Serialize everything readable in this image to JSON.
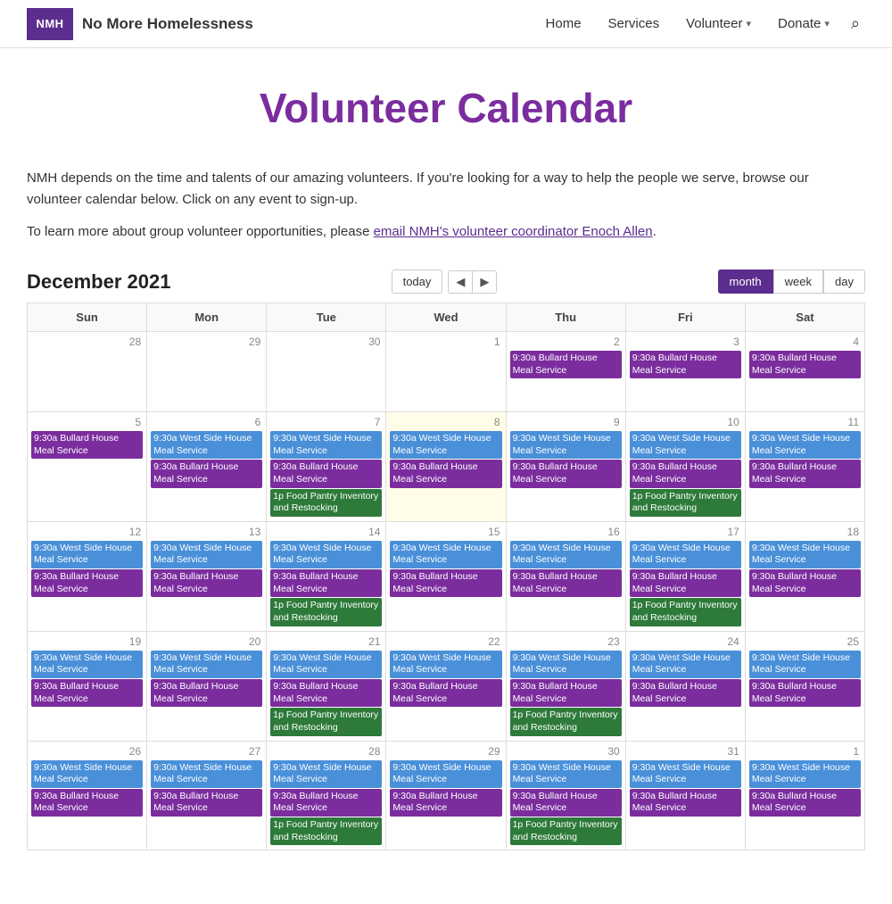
{
  "header": {
    "logo_text": "NMH",
    "site_name": "No More Homelessness",
    "nav_items": [
      {
        "label": "Home",
        "has_dropdown": false
      },
      {
        "label": "Services",
        "has_dropdown": false
      },
      {
        "label": "Volunteer",
        "has_dropdown": true
      },
      {
        "label": "Donate",
        "has_dropdown": true
      }
    ]
  },
  "page": {
    "title": "Volunteer Calendar",
    "intro1": "NMH depends on the time and talents of our amazing volunteers. If you're looking for a way to help the people we serve, browse our volunteer calendar below. Click on any event to sign-up.",
    "intro2_prefix": "To learn more about group volunteer opportunities, please ",
    "intro2_link": "email NMH's volunteer coordinator Enoch Allen",
    "intro2_suffix": "."
  },
  "calendar": {
    "month_label": "December 2021",
    "today_btn": "today",
    "view_buttons": [
      "month",
      "week",
      "day"
    ],
    "active_view": "month",
    "day_headers": [
      "Sun",
      "Mon",
      "Tue",
      "Wed",
      "Thu",
      "Fri",
      "Sat"
    ],
    "event_types": {
      "meal_service": {
        "label": "9:30a Bullard House Meal Service",
        "class": "event-purple"
      },
      "west_side": {
        "label": "9:30a West Side House Meal Service",
        "class": "event-blue"
      },
      "food_pantry": {
        "label": "1p Food Pantry Inventory and Restocking",
        "class": "event-green"
      }
    }
  }
}
